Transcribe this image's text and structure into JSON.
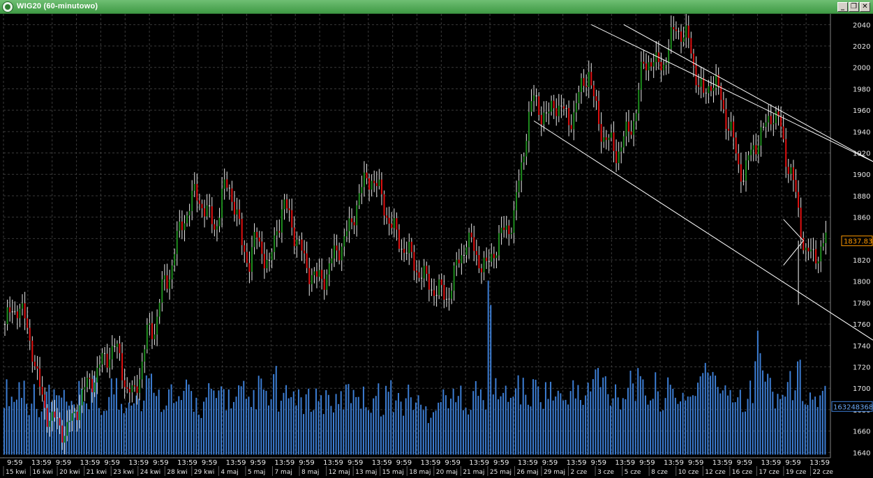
{
  "window": {
    "title": "WIG20 (60-minutowo)",
    "minimize_label": "_",
    "restore_label": "❐",
    "close_label": "✕"
  },
  "colors": {
    "background": "#000000",
    "grid": "#3a3a3a",
    "up_candle": "#1e8c1e",
    "down_candle": "#e01010",
    "neutral_candle": "#e8e8e8",
    "volume": "#3d7fd6",
    "trendline": "#ffffff",
    "price_badge": "#ff9900",
    "volume_badge": "#3d7fd6"
  },
  "chart_data": {
    "type": "candlestick",
    "title": "WIG20 (60-minutowo)",
    "ylim": [
      1635,
      2050
    ],
    "y_ticks": [
      1640,
      1660,
      1680,
      1700,
      1720,
      1740,
      1760,
      1780,
      1800,
      1820,
      1840,
      1860,
      1880,
      1900,
      1920,
      1940,
      1960,
      1980,
      2000,
      2020,
      2040
    ],
    "grid": true,
    "time_labels": [
      "9:59",
      "13:59",
      "9:59",
      "13:59",
      "9:59",
      "13:59",
      "9:59",
      "13:59",
      "9:59",
      "13:59",
      "9:59",
      "13:59",
      "9:59",
      "13:59",
      "9:59",
      "13:59",
      "9:59",
      "13:59",
      "9:59",
      "13:59",
      "9:59",
      "13:59",
      "9:59",
      "13:59",
      "9:59",
      "13:59",
      "9:59",
      "13:59",
      "9:59",
      "13:59",
      "9:59",
      "13:59",
      "9:59",
      "13:59"
    ],
    "date_labels": [
      "15 kwi",
      "16 kwi",
      "20 kwi",
      "21 kwi",
      "23 kwi",
      "24 kwi",
      "28 kwi",
      "29 kwi",
      "4 maj",
      "5 maj",
      "7 maj",
      "8 maj",
      "12 maj",
      "13 maj",
      "15 maj",
      "18 maj",
      "20 maj",
      "21 maj",
      "25 maj",
      "26 maj",
      "29 maj",
      "2 cze",
      "3 cze",
      "5 cze",
      "8 cze",
      "10 cze",
      "12 cze",
      "16 cze",
      "17 cze",
      "19 cze",
      "22 cze"
    ],
    "price_path": [
      1760,
      1770,
      1780,
      1760,
      1740,
      1700,
      1680,
      1670,
      1665,
      1660,
      1670,
      1690,
      1700,
      1710,
      1720,
      1730,
      1740,
      1725,
      1700,
      1690,
      1720,
      1750,
      1755,
      1790,
      1800,
      1830,
      1850,
      1870,
      1880,
      1875,
      1860,
      1850,
      1880,
      1890,
      1870,
      1830,
      1820,
      1840,
      1830,
      1810,
      1850,
      1870,
      1860,
      1840,
      1820,
      1810,
      1800,
      1805,
      1815,
      1830,
      1840,
      1850,
      1880,
      1890,
      1900,
      1885,
      1870,
      1850,
      1840,
      1830,
      1820,
      1810,
      1800,
      1795,
      1790,
      1785,
      1800,
      1820,
      1840,
      1830,
      1820,
      1810,
      1830,
      1840,
      1850,
      1860,
      1900,
      1950,
      1970,
      1960,
      1950,
      1970,
      1960,
      1950,
      1960,
      1980,
      2000,
      1960,
      1940,
      1930,
      1920,
      1930,
      1940,
      1960,
      2000,
      2010,
      2000,
      2005,
      2020,
      2040,
      2030,
      2020,
      1990,
      1970,
      1990,
      1980,
      1960,
      1940,
      1910,
      1900,
      1920,
      1935,
      1940,
      1960,
      1950,
      1920,
      1900,
      1860,
      1830,
      1820,
      1830,
      1837.83
    ],
    "last_price": "1837.83",
    "last_volume": "163248368",
    "volume_profile": [
      0.42,
      0.38,
      0.46,
      0.35,
      0.41,
      0.3,
      0.44,
      0.39,
      0.37,
      0.33,
      0.29,
      0.4,
      0.36,
      0.43,
      0.31,
      0.38,
      0.45,
      0.34,
      0.39,
      0.41,
      0.36,
      0.47,
      0.5,
      0.38,
      0.42,
      0.33,
      0.37,
      0.41,
      0.35,
      0.32,
      0.4,
      0.36,
      0.43,
      0.38,
      0.35,
      0.41,
      0.32,
      0.39,
      0.44,
      0.36,
      0.49,
      0.34,
      0.38,
      0.42,
      0.31,
      0.36,
      0.4,
      0.35,
      0.39,
      0.33,
      0.37,
      0.41,
      0.45,
      0.38,
      0.36,
      0.4,
      0.34,
      0.42,
      0.37,
      0.33,
      0.39,
      0.36,
      0.3,
      0.28,
      0.35,
      0.38,
      0.41,
      0.36,
      0.4,
      0.34,
      0.42,
      0.38,
      0.95,
      0.45,
      0.4,
      0.36,
      0.48,
      0.42,
      0.38,
      0.44,
      0.41,
      0.46,
      0.39,
      0.37,
      0.43,
      0.4,
      0.38,
      0.45,
      0.55,
      0.48,
      0.41,
      0.44,
      0.39,
      0.52,
      0.47,
      0.43,
      0.4,
      0.45,
      0.38,
      0.42,
      0.36,
      0.41,
      0.39,
      0.47,
      0.52,
      0.6,
      0.45,
      0.5,
      0.44,
      0.4,
      0.38,
      0.42,
      0.7,
      0.55,
      0.48,
      0.4,
      0.42,
      0.46,
      0.53,
      0.43,
      0.39,
      0.36,
      0.4
    ]
  }
}
